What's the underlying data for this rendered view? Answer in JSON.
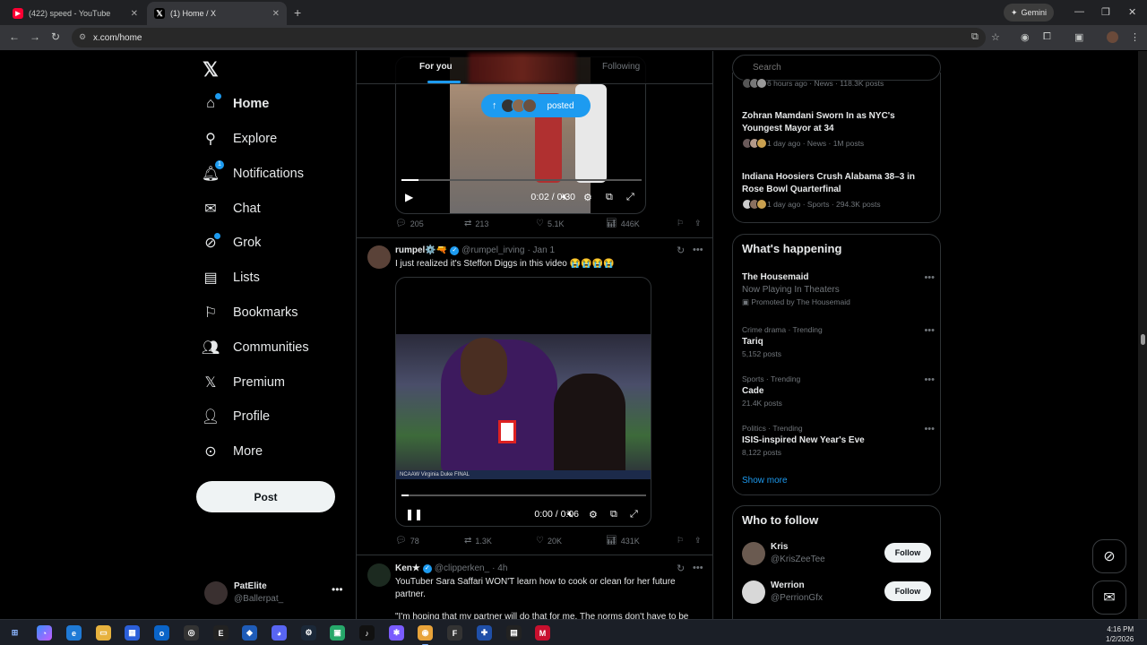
{
  "browser": {
    "tabs": [
      {
        "title": "(422) speed - YouTube",
        "favicon": "youtube-icon"
      },
      {
        "title": "(1) Home / X",
        "favicon": "x-icon",
        "active": true
      }
    ],
    "gemini_label": "Gemini",
    "url": "x.com/home"
  },
  "nav": {
    "items": [
      {
        "label": "Home",
        "icon": "home-icon",
        "active": true
      },
      {
        "label": "Explore",
        "icon": "search-icon"
      },
      {
        "label": "Notifications",
        "icon": "bell-icon",
        "badge": "1"
      },
      {
        "label": "Chat",
        "icon": "mail-icon"
      },
      {
        "label": "Grok",
        "icon": "grok-icon"
      },
      {
        "label": "Lists",
        "icon": "list-icon"
      },
      {
        "label": "Bookmarks",
        "icon": "bookmark-icon"
      },
      {
        "label": "Communities",
        "icon": "people-icon"
      },
      {
        "label": "Premium",
        "icon": "x-icon"
      },
      {
        "label": "Profile",
        "icon": "person-icon"
      },
      {
        "label": "More",
        "icon": "more-circle-icon"
      }
    ],
    "post_label": "Post",
    "account": {
      "name": "PatElite",
      "handle": "@Ballerpat_"
    }
  },
  "feed": {
    "tabs": {
      "for_you": "For you",
      "following": "Following"
    },
    "new_posts_pill": "posted",
    "tweets": [
      {
        "video": {
          "time": "0:02 / 0:30",
          "progress": 0.07,
          "state": "paused"
        },
        "stats": {
          "replies": "205",
          "reposts": "213",
          "likes": "5.1K",
          "views": "446K"
        }
      },
      {
        "name": "rumpel⚙️🔫",
        "handle": "@rumpel_irving",
        "date": "· Jan 1",
        "text": "I just realized it's Steffon Diggs in this video 😭😭😭😭",
        "video": {
          "time": "0:00 / 0:06",
          "progress": 0.03,
          "state": "playing",
          "ticker": "NCAAW  Virginia  Duke  FINAL"
        },
        "stats": {
          "replies": "78",
          "reposts": "1.3K",
          "likes": "20K",
          "views": "431K"
        }
      },
      {
        "name": "Ken★",
        "handle": "@clipperken_",
        "date": "· 4h",
        "text": "YouTuber Sara Saffari WON'T learn how to cook or clean for her future partner.",
        "text2": "\"I'm hoping that my partner will do that for me. The norms don't have to be"
      }
    ]
  },
  "right": {
    "search_placeholder": "Search",
    "news": [
      {
        "headline": "",
        "meta": "6 hours ago · News · 118.3K posts"
      },
      {
        "headline": "Zohran Mamdani Sworn In as NYC's Youngest Mayor at 34",
        "meta": "1 day ago · News · 1M posts"
      },
      {
        "headline": "Indiana Hoosiers Crush Alabama 38–3 in Rose Bowl Quarterfinal",
        "meta": "1 day ago · Sports · 294.3K posts"
      }
    ],
    "whats_happening": {
      "title": "What's happening",
      "trends": [
        {
          "name": "The Housemaid",
          "sub": "Now Playing In Theaters",
          "promo": "Promoted by The Housemaid"
        },
        {
          "context": "Crime drama · Trending",
          "name": "Tariq",
          "count": "5,152 posts"
        },
        {
          "context": "Sports · Trending",
          "name": "Cade",
          "count": "21.4K posts"
        },
        {
          "context": "Politics · Trending",
          "name": "ISIS-inspired New Year's Eve",
          "count": "8,122 posts"
        }
      ],
      "show_more": "Show more"
    },
    "who_to_follow": {
      "title": "Who to follow",
      "users": [
        {
          "name": "Kris",
          "handle": "@KrisZeeTee",
          "button": "Follow"
        },
        {
          "name": "Werrion",
          "handle": "@PerrionGfx",
          "button": "Follow"
        }
      ]
    }
  },
  "taskbar": {
    "time": "4:16 PM",
    "date": "1/2/2026"
  },
  "colors": {
    "accent": "#1d9bf0",
    "bg": "#000000",
    "text": "#e7e9ea",
    "muted": "#71767b",
    "border": "#2f3336"
  }
}
